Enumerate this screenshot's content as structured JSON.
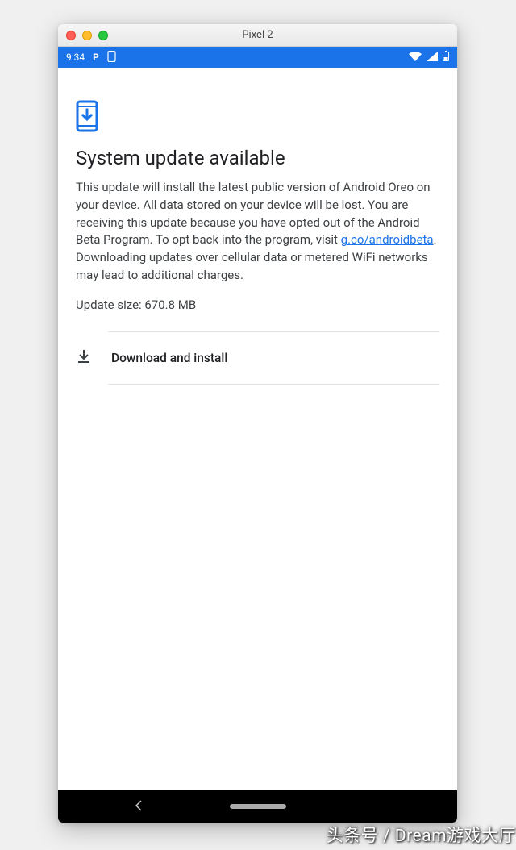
{
  "window": {
    "title": "Pixel 2"
  },
  "statusbar": {
    "time": "9:34",
    "icon1": "P",
    "icon2": "phone-update"
  },
  "update": {
    "heading": "System update available",
    "body_pre": "This update will install the latest public version of Android Oreo on your device. All data stored on your device will be lost. You are receiving this update because you have opted out of the Android Beta Program. To opt back into the program, visit ",
    "link_text": "g.co/androidbeta",
    "body_post": ". Downloading updates over cellular data or metered WiFi networks may lead to additional charges.",
    "size_label": "Update size: 670.8 MB",
    "action_label": "Download and install"
  },
  "watermark": "头条号 / Dream游戏大厅"
}
